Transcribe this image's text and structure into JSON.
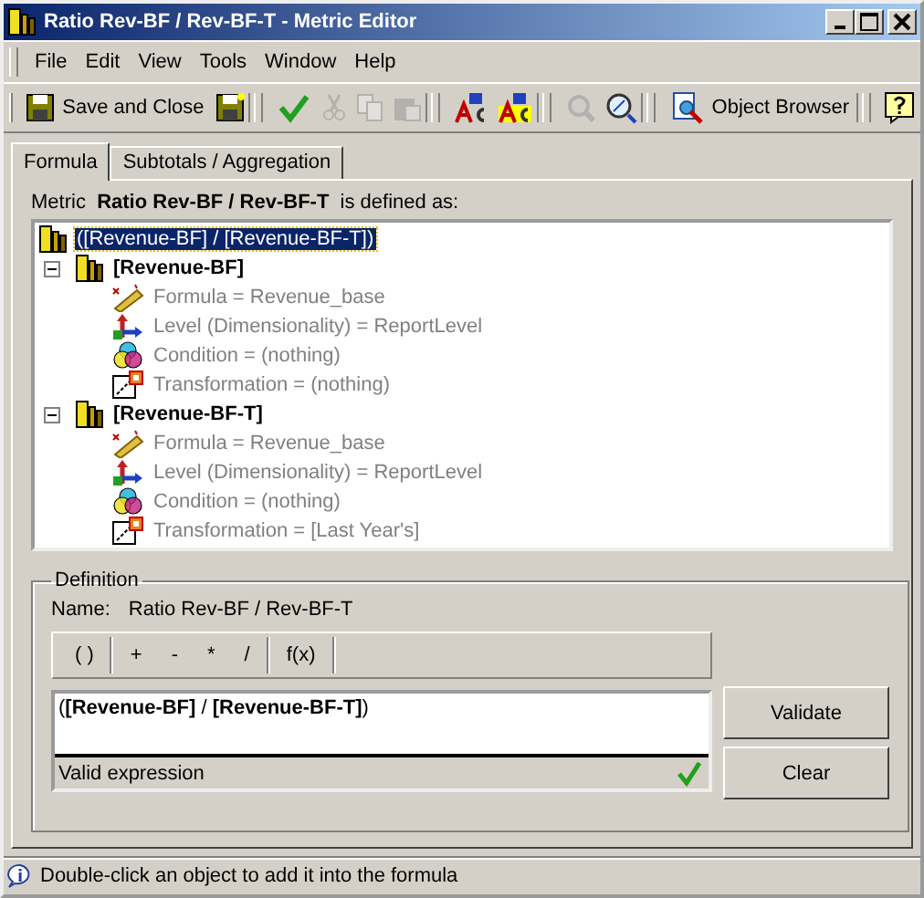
{
  "window": {
    "title": "Ratio Rev-BF / Rev-BF-T - Metric Editor"
  },
  "menu": [
    "File",
    "Edit",
    "View",
    "Tools",
    "Window",
    "Help"
  ],
  "toolbar": [
    {
      "kind": "save",
      "label": "Save and Close",
      "disabled": false
    },
    {
      "kind": "save-new",
      "disabled": false
    },
    {
      "kind": "separator"
    },
    {
      "kind": "check",
      "disabled": false
    },
    {
      "kind": "cut",
      "disabled": true
    },
    {
      "kind": "copy",
      "disabled": true
    },
    {
      "kind": "paste",
      "disabled": true
    },
    {
      "kind": "separator"
    },
    {
      "kind": "spell",
      "disabled": false
    },
    {
      "kind": "spell-all",
      "disabled": false
    },
    {
      "kind": "separator"
    },
    {
      "kind": "find",
      "disabled": true
    },
    {
      "kind": "zoom",
      "disabled": false
    },
    {
      "kind": "separator"
    },
    {
      "kind": "browser",
      "label": "Object Browser",
      "disabled": false
    },
    {
      "kind": "separator"
    },
    {
      "kind": "help",
      "disabled": false
    }
  ],
  "tabs": [
    {
      "label": "Formula",
      "selected": true
    },
    {
      "label": "Subtotals / Aggregation",
      "selected": false
    }
  ],
  "metric_caption": "Metric  **Ratio Rev-BF / Rev-BF-T**  is defined as:",
  "tree": {
    "label": "([Revenue-BF] / [Revenue-BF-T])",
    "selected": true,
    "children": [
      {
        "label": "[Revenue-BF]",
        "expanded": true,
        "selected": false,
        "children": [
          {
            "kind": "formula",
            "label": "Formula = Revenue_base"
          },
          {
            "kind": "level",
            "label": "Level (Dimensionality) = ReportLevel"
          },
          {
            "kind": "condition",
            "label": "Condition = (nothing)"
          },
          {
            "kind": "transformation",
            "label": "Transformation = (nothing)"
          }
        ]
      },
      {
        "label": "[Revenue-BF-T]",
        "expanded": true,
        "selected": false,
        "children": [
          {
            "kind": "formula",
            "label": "Formula = Revenue_base"
          },
          {
            "kind": "level",
            "label": "Level (Dimensionality) = ReportLevel"
          },
          {
            "kind": "condition",
            "label": "Condition = (nothing)"
          },
          {
            "kind": "transformation",
            "label": "Transformation = [Last Year's]"
          }
        ]
      }
    ]
  },
  "definition": {
    "title": "Definition",
    "name_label": "Name:",
    "name": "Ratio Rev-BF / Rev-BF-T",
    "operators": [
      [
        "( )"
      ],
      [
        "+",
        "-",
        "*",
        "/"
      ],
      [
        "f(x)"
      ]
    ],
    "formula": "(**[Revenue-BF]** / **[Revenue-BF-T]**)",
    "status": "Valid expression",
    "valid": true,
    "buttons": [
      "Validate",
      "Clear"
    ]
  },
  "status_bar": "Double-click an object to add it into the formula"
}
